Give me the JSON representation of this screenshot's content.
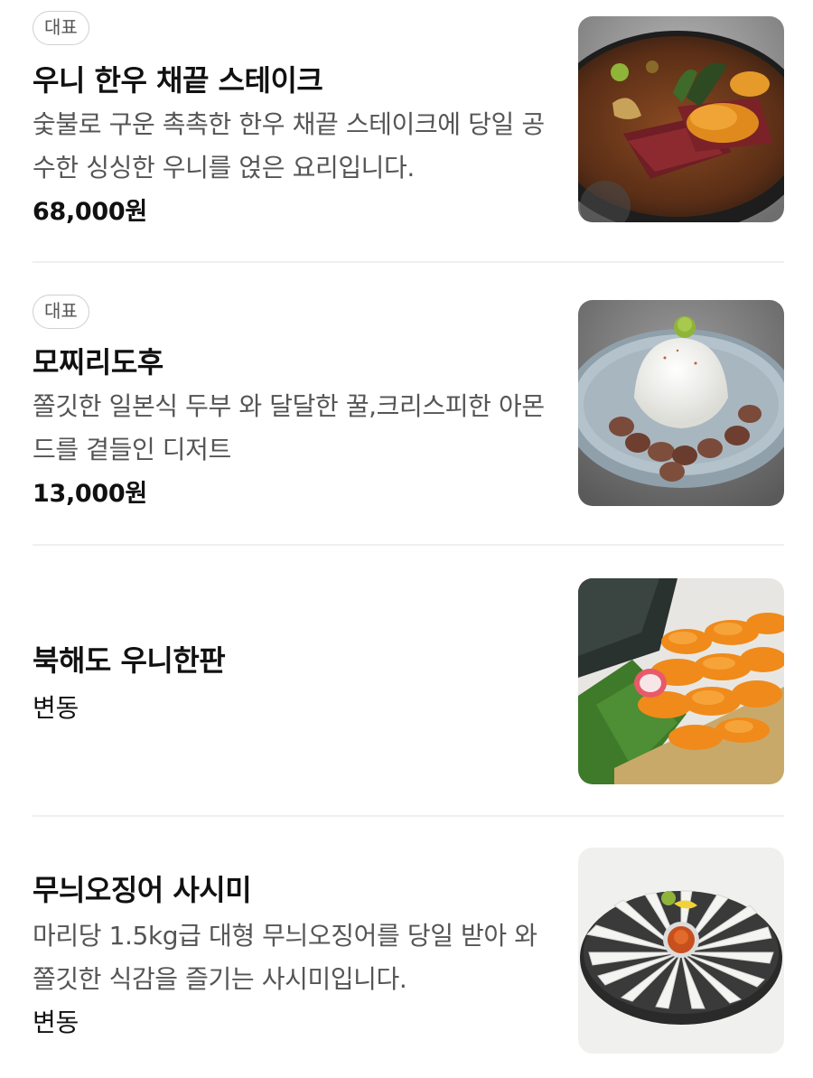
{
  "menu": {
    "items": [
      {
        "badge": "대표",
        "name": "우니 한우 채끝 스테이크",
        "description": "숯불로 구운 촉촉한 한우 채끝 스테이크에 당일 공수한 싱싱한 우니를 얹은 요리입니다.",
        "price": "68,000원",
        "image_icon": "steak-with-sea-urchin-photo"
      },
      {
        "badge": "대표",
        "name": "모찌리도후",
        "description": "쫄깃한 일본식 두부 와 달달한 꿀,크리스피한 아몬드를 곁들인 디저트",
        "price": "13,000원",
        "image_icon": "mochi-tofu-dessert-photo"
      },
      {
        "name": "북해도 우니한판",
        "price": "변동",
        "image_icon": "sea-urchin-tray-photo"
      },
      {
        "name": "무늬오징어 사시미",
        "description": "마리당 1.5kg급 대형 무늬오징어를 당일 받아 와 쫄깃한 식감을 즐기는 사시미입니다.",
        "price": "변동",
        "image_icon": "squid-sashimi-platter-photo"
      }
    ]
  }
}
